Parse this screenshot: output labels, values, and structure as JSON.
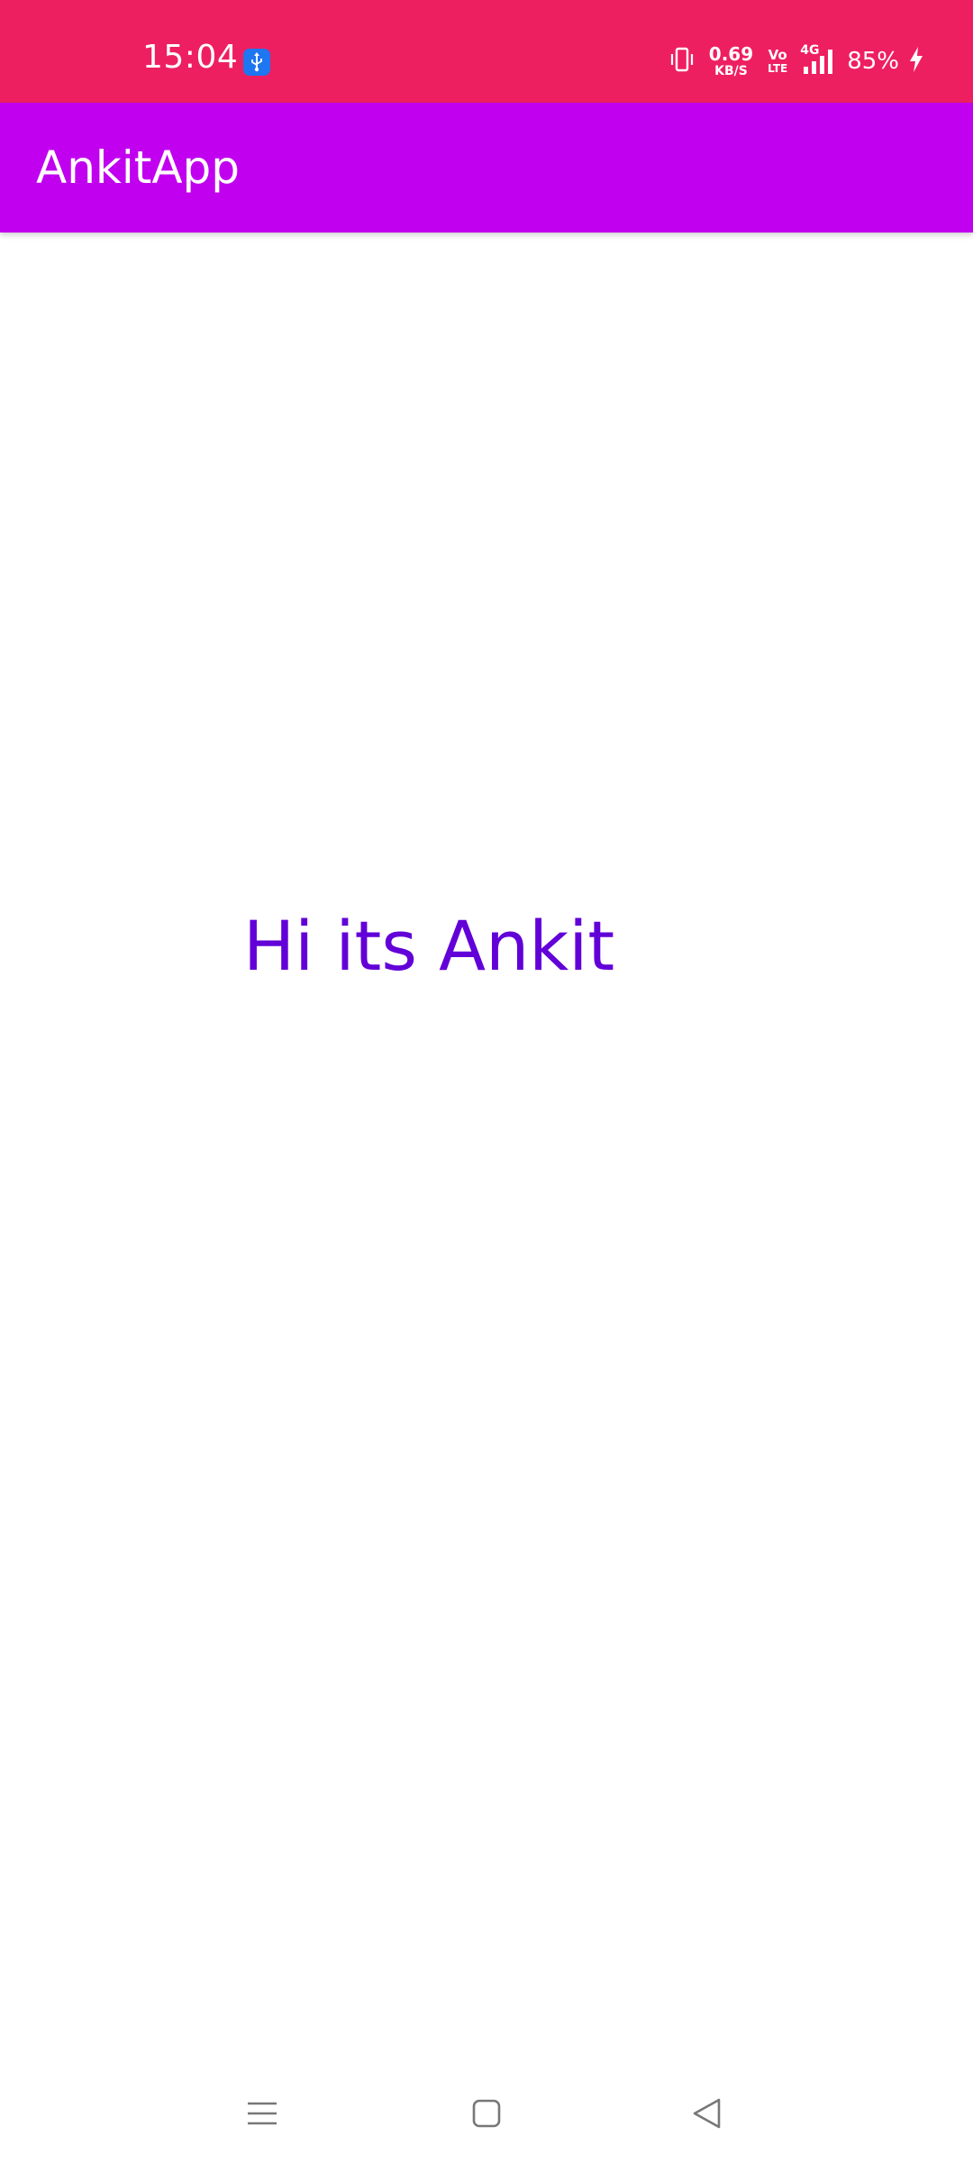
{
  "status_bar": {
    "time": "15:04",
    "net_speed_value": "0.69",
    "net_speed_unit": "KB/S",
    "volte_top": "Vo",
    "volte_bottom": "LTE",
    "network_type": "4G",
    "battery": "85%",
    "background_color": "#ee1f60",
    "icons": [
      "usb-icon",
      "vibrate-icon",
      "signal-icon",
      "charging-icon"
    ]
  },
  "app_bar": {
    "title": "AnkitApp",
    "background_color": "#c000ef"
  },
  "main": {
    "greeting": "Hi its Ankit",
    "greeting_color": "#6200d8"
  },
  "nav_bar": {
    "icons": [
      "menu-icon",
      "home-icon",
      "back-icon"
    ]
  }
}
